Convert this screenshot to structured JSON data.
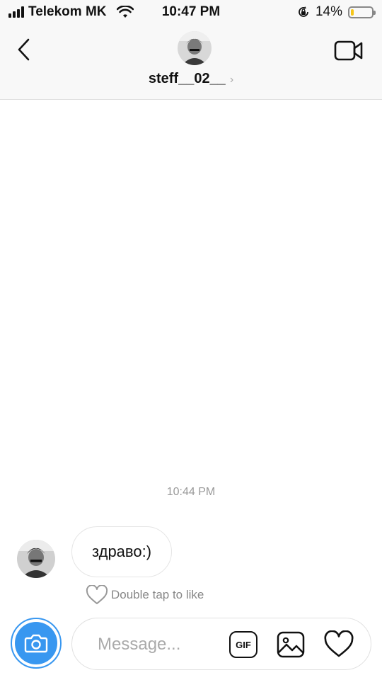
{
  "status_bar": {
    "carrier": "Telekom MK",
    "time": "10:47 PM",
    "battery_percent": "14%",
    "battery_level": 0.14,
    "icons": [
      "signal-icon",
      "wifi-icon",
      "orientation-lock-icon",
      "battery-icon"
    ]
  },
  "header": {
    "username": "steff__02__",
    "back_icon": "chevron-left-icon",
    "video_icon": "video-camera-icon"
  },
  "conversation": {
    "timestamp": "10:44 PM",
    "messages": [
      {
        "text": "здраво:)",
        "from": "other"
      }
    ],
    "like_hint": "Double tap to like"
  },
  "composer": {
    "placeholder": "Message...",
    "gif_label": "GIF",
    "accent": "#3897f0"
  },
  "colors": {
    "accent": "#3897f0",
    "battery_low": "#f5c518"
  }
}
